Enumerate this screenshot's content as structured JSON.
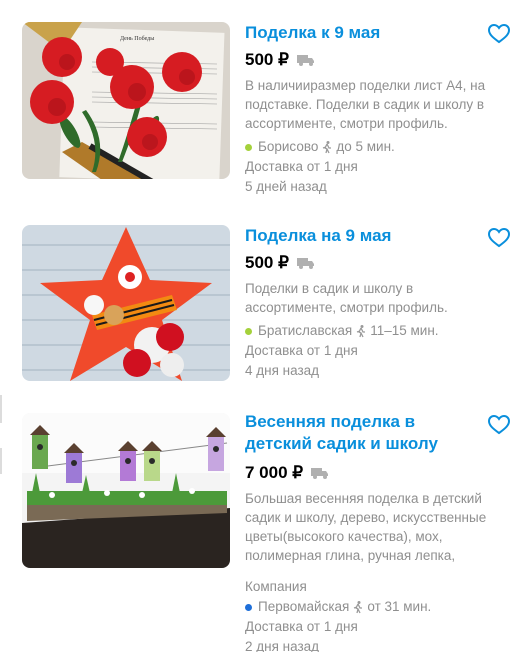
{
  "listings": [
    {
      "title": "Поделка к 9 мая",
      "price": "500 ₽",
      "description": "В наличиирaзмер поделки лист А4, на подставке. Поделки в садик и школу в ассортименте, смотри профиль.",
      "company": "",
      "metro": "Борисово",
      "metro_color": "#a4d13b",
      "walk_time": "до 5 мин.",
      "delivery": "Доставка от 1 дня",
      "posted": "5 дней назад",
      "thumb_caption": "День Победы"
    },
    {
      "title": "Поделка на 9 мая",
      "price": "500 ₽",
      "description": "Поделки в садик и школу в ассортименте, смотри профиль.",
      "company": "",
      "metro": "Братиславская",
      "metro_color": "#a4d13b",
      "walk_time": "11–15 мин.",
      "delivery": "Доставка от 1 дня",
      "posted": "4 дня назад"
    },
    {
      "title": "Весенняя поделка в детский садик и школу",
      "price": "7 000 ₽",
      "description": "Большая весенняя поделка в детский садик и школу, дерево, искусственные цветы(высокого качества), мох, полимерная глина, ручная лепка,",
      "company": "Компания",
      "metro": "Первомайская",
      "metro_color": "#1e6fd9",
      "walk_time": "от 31 мин.",
      "delivery": "Доставка от 1 дня",
      "posted": "2 дня назад"
    }
  ],
  "colors": {
    "title": "#0a8fdc",
    "muted": "#8f8f8f",
    "heart": "#0a8fdc"
  },
  "icons": {
    "favorite": "heart-outline-icon",
    "delivery": "truck-icon",
    "walk": "walking-person-icon"
  }
}
